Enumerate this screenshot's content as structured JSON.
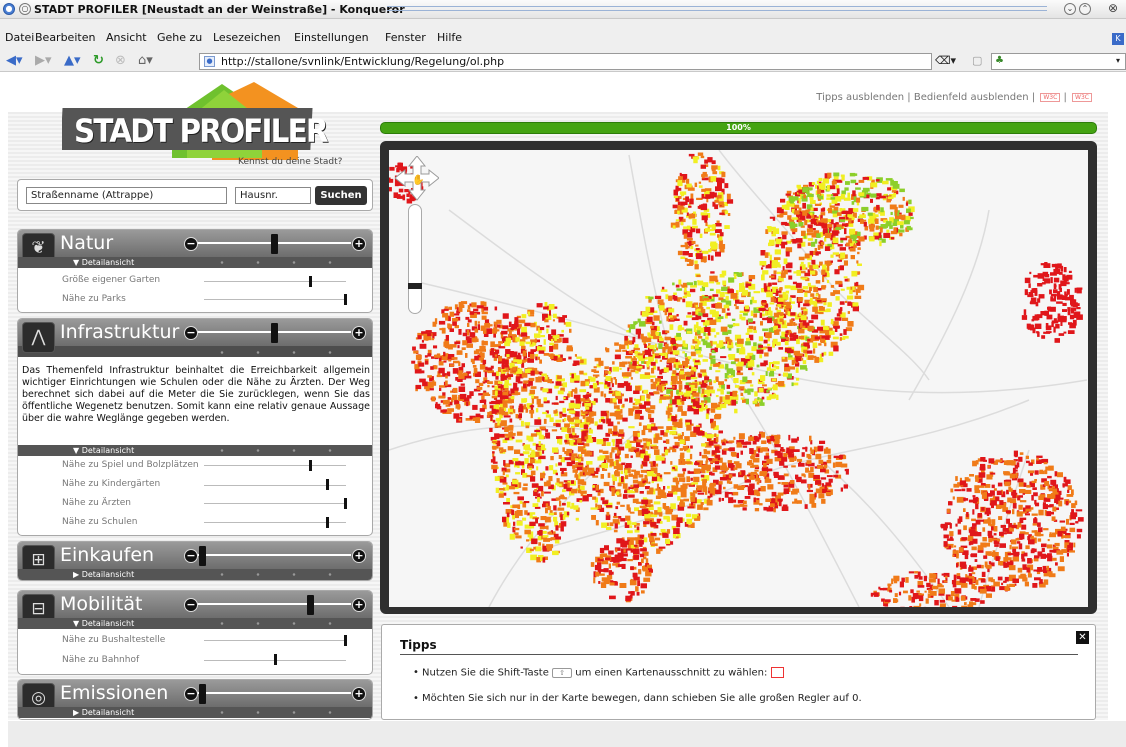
{
  "window": {
    "title": "STADT PROFILER [Neustadt an der Weinstraße] - Konqueror"
  },
  "menu": [
    "Datei",
    "Bearbeiten",
    "Ansicht",
    "Gehe zu",
    "Lesezeichen",
    "Einstellungen",
    "Fenster",
    "Hilfe"
  ],
  "toolbar": {
    "url": "http://stallone/svnlink/Entwicklung/Regelung/ol.php"
  },
  "top_links": {
    "tips": "Tipps ausblenden",
    "panel": "Bedienfeld ausblenden",
    "sep": "|",
    "badge1": "W3C",
    "badge2": "W3C"
  },
  "logo": {
    "text": "STADT PROFILER",
    "tagline": "Kennst du deine Stadt?"
  },
  "search": {
    "street_value": "Straßenname (Attrappe)",
    "house_value": "Hausnr.",
    "button": "Suchen"
  },
  "detail_label_open": "▼ Detailansicht",
  "detail_label_closed": "▶ Detailansicht",
  "panels": {
    "natur": {
      "title": "Natur",
      "level": 0.5,
      "subs": [
        {
          "label": "Größe eigener Garten",
          "value": 0.75
        },
        {
          "label": "Nähe zu Parks",
          "value": 1.0
        }
      ]
    },
    "infra": {
      "title": "Infrastruktur",
      "level": 0.5,
      "description": "Das Themenfeld Infrastruktur beinhaltet die Erreichbarkeit allgemein wichtiger Einrichtungen wie Schulen oder die Nähe zu Ärzten. Der Weg berechnet sich dabei auf die Meter die Sie zurücklegen, wenn Sie das öffentliche Wegenetz benutzen. Somit kann eine relativ genaue Aussage über die wahre Weglänge gegeben werden.",
      "subs": [
        {
          "label": "Nähe zu Spiel und Bolzplätzen",
          "value": 0.75
        },
        {
          "label": "Nähe zu Kindergärten",
          "value": 0.87
        },
        {
          "label": "Nähe zu Ärzten",
          "value": 1.0
        },
        {
          "label": "Nähe zu Schulen",
          "value": 0.87
        }
      ]
    },
    "einkaufen": {
      "title": "Einkaufen",
      "level": 0.0
    },
    "mobilitaet": {
      "title": "Mobilität",
      "level": 0.75,
      "subs": [
        {
          "label": "Nähe zu Bushaltestelle",
          "value": 1.0
        },
        {
          "label": "Nähe zu Bahnhof",
          "value": 0.5
        }
      ]
    },
    "emissionen": {
      "title": "Emissionen",
      "level": 0.0
    }
  },
  "progress": {
    "label": "100%",
    "value": 1.0
  },
  "tips": {
    "heading": "Tipps",
    "tip1_a": "Nutzen Sie die Shift-Taste",
    "tip1_b": "um einen Kartenausschnitt zu wählen:",
    "tip2": "Möchten Sie sich nur in der Karte bewegen, dann schieben Sie alle großen Regler auf 0."
  },
  "colors": {
    "progress": "#44a312",
    "map_red": "#e0161a",
    "map_orange": "#f07b18",
    "map_yellow": "#f1ef22",
    "map_green": "#8ccf2a"
  }
}
